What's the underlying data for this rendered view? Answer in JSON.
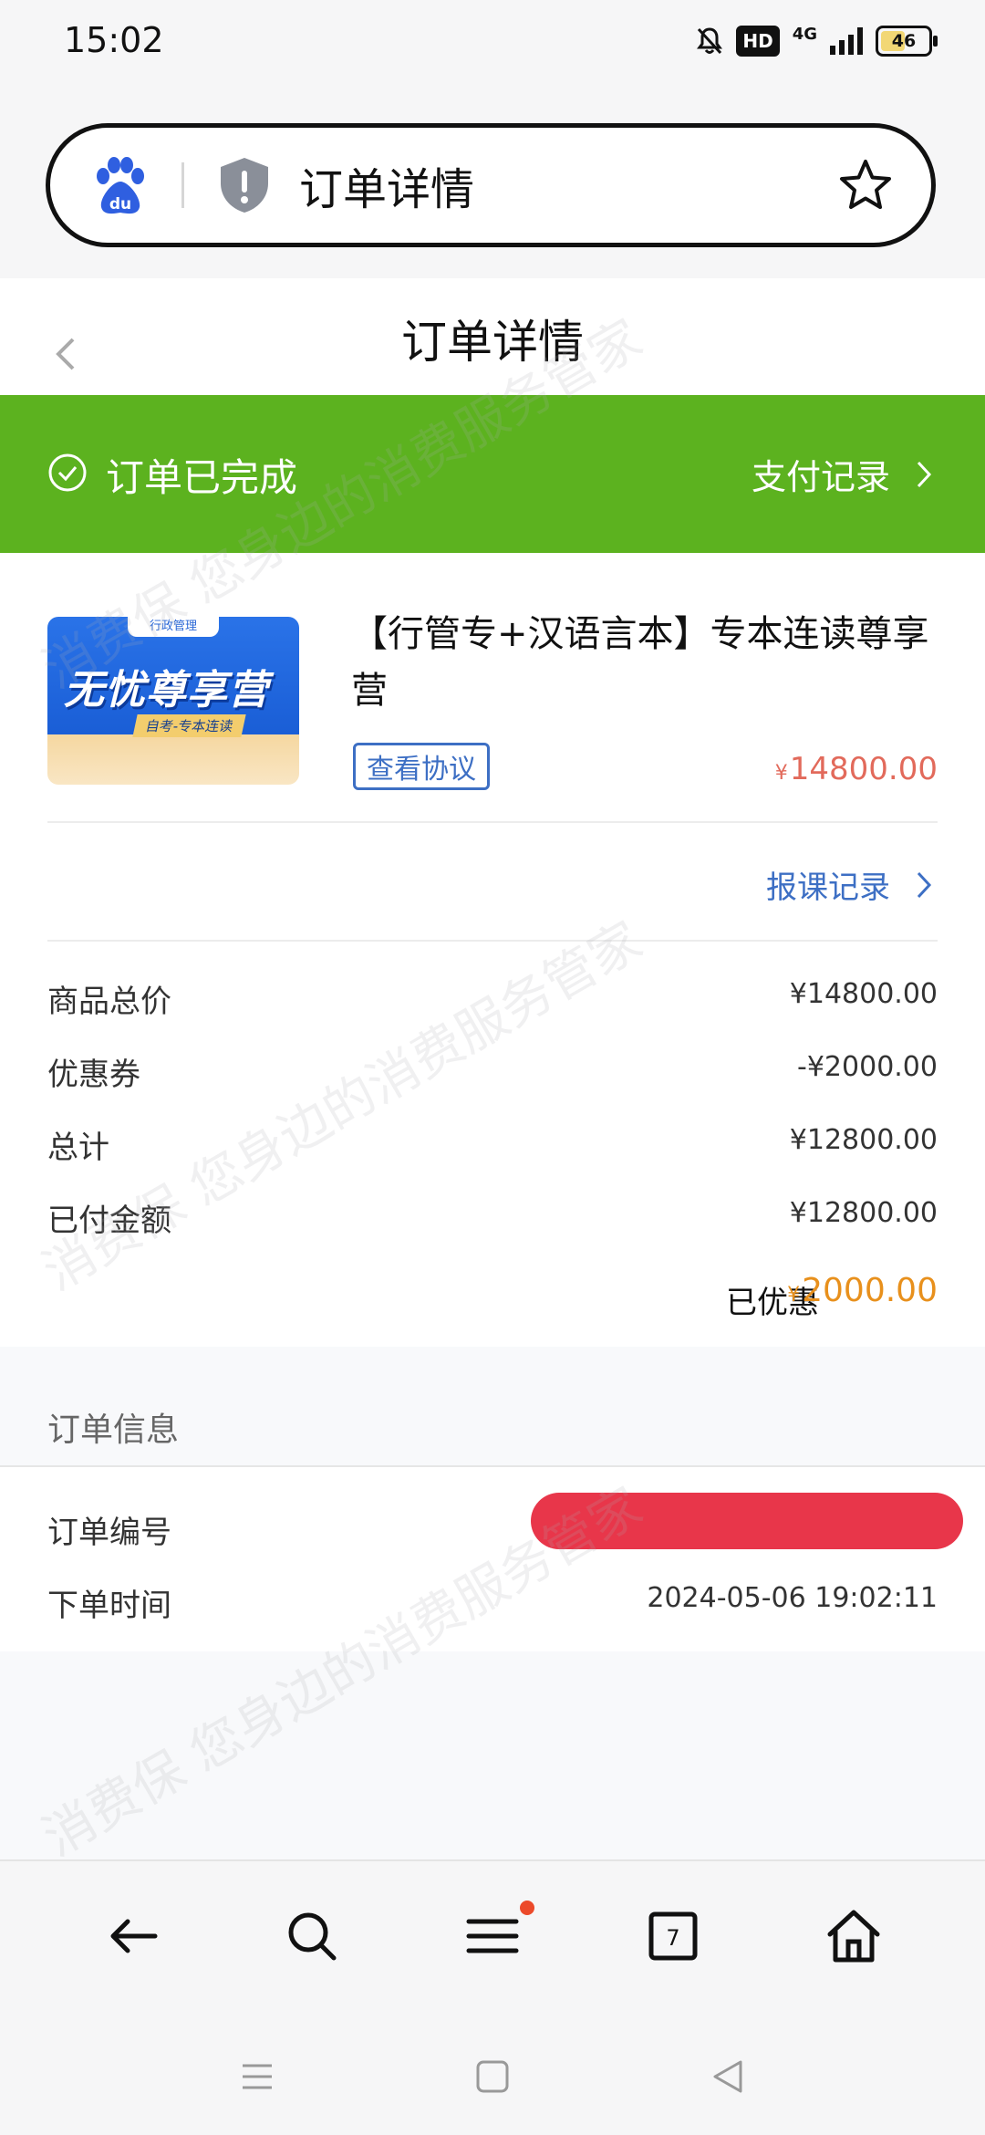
{
  "status_bar": {
    "time": "15:02",
    "hd": "HD",
    "network": "4G",
    "battery": "46"
  },
  "browser": {
    "url_title": "订单详情"
  },
  "header": {
    "title": "订单详情"
  },
  "banner": {
    "status": "订单已完成",
    "pay_record": "支付记录",
    "color": "#5cb21f"
  },
  "product": {
    "thumb_tag": "行政管理",
    "thumb_title": "无忧尊享营",
    "thumb_sub": "自考-专本连读",
    "title": "【行管专+汉语言本】专本连读尊享营",
    "agreement_btn": "查看协议",
    "price_symbol": "¥",
    "price": "14800.00",
    "enroll_record": "报课记录"
  },
  "summary": {
    "rows": [
      {
        "label": "商品总价",
        "value": "¥14800.00"
      },
      {
        "label": "优惠券",
        "value": "-¥2000.00"
      },
      {
        "label": "总计",
        "value": "¥12800.00"
      },
      {
        "label": "已付金额",
        "value": "¥12800.00"
      }
    ],
    "saved_label": "已优惠",
    "saved_symbol": "¥",
    "saved_value": "2000.00"
  },
  "order_info": {
    "title": "订单信息",
    "rows": [
      {
        "label": "订单编号",
        "value": ""
      },
      {
        "label": "下单时间",
        "value": "2024-05-06 19:02:11"
      }
    ]
  },
  "toolbar": {
    "tabs_count": "7"
  },
  "watermark": "消费保 您身边的消费服务管家"
}
